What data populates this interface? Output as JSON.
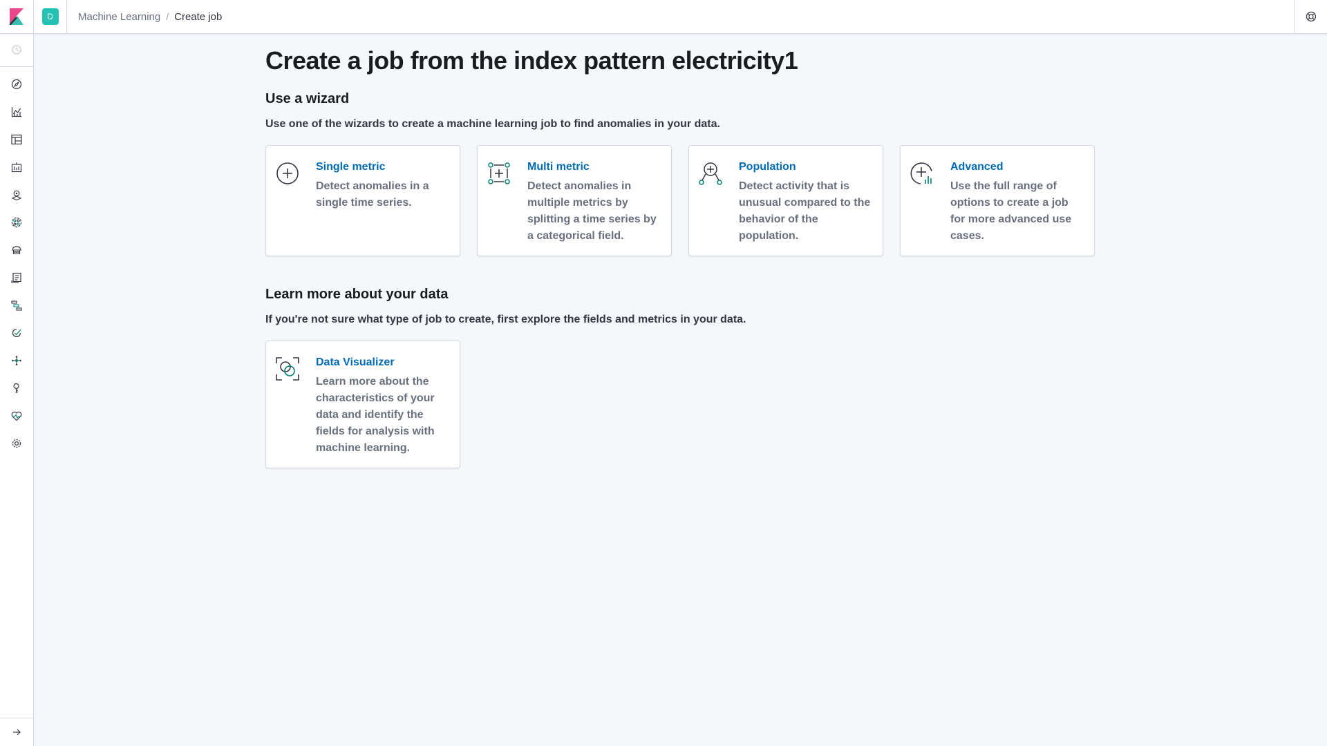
{
  "header": {
    "space_initial": "D",
    "breadcrumbs": [
      "Machine Learning",
      "Create job"
    ],
    "breadcrumb_separator": "/"
  },
  "sidebar": {
    "items": [
      {
        "icon": "recently-viewed-icon"
      },
      {
        "icon": "discover-icon"
      },
      {
        "icon": "visualize-icon"
      },
      {
        "icon": "dashboard-icon"
      },
      {
        "icon": "canvas-icon"
      },
      {
        "icon": "maps-icon"
      },
      {
        "icon": "machine-learning-icon",
        "active": true
      },
      {
        "icon": "infrastructure-icon"
      },
      {
        "icon": "logs-icon"
      },
      {
        "icon": "apm-icon"
      },
      {
        "icon": "uptime-icon"
      },
      {
        "icon": "graph-icon"
      },
      {
        "icon": "dev-tools-icon"
      },
      {
        "icon": "monitoring-icon"
      },
      {
        "icon": "management-icon"
      },
      {
        "icon": "expand-arrow-icon"
      }
    ]
  },
  "main": {
    "title": "Create a job from the index pattern electricity1",
    "wizard_section": {
      "title": "Use a wizard",
      "description": "Use one of the wizards to create a machine learning job to find anomalies in your data.",
      "cards": [
        {
          "title": "Single metric",
          "description": "Detect anomalies in a single time series.",
          "icon": "single-metric-icon"
        },
        {
          "title": "Multi metric",
          "description": "Detect anomalies in multiple metrics by splitting a time series by a categorical field.",
          "icon": "multi-metric-icon"
        },
        {
          "title": "Population",
          "description": "Detect activity that is unusual compared to the behavior of the population.",
          "icon": "population-icon"
        },
        {
          "title": "Advanced",
          "description": "Use the full range of options to create a job for more advanced use cases.",
          "icon": "advanced-icon"
        }
      ]
    },
    "learn_section": {
      "title": "Learn more about your data",
      "description": "If you're not sure what type of job to create, first explore the fields and metrics in your data.",
      "cards": [
        {
          "title": "Data Visualizer",
          "description": "Learn more about the characteristics of your data and identify the fields for analysis with machine learning.",
          "icon": "data-visualizer-icon"
        }
      ]
    }
  },
  "colors": {
    "link": "#006bb4",
    "accent_teal": "#017d73",
    "space_avatar": "#24c2b5",
    "logo_pink": "#e8488b",
    "logo_teal": "#3ebeb0"
  }
}
